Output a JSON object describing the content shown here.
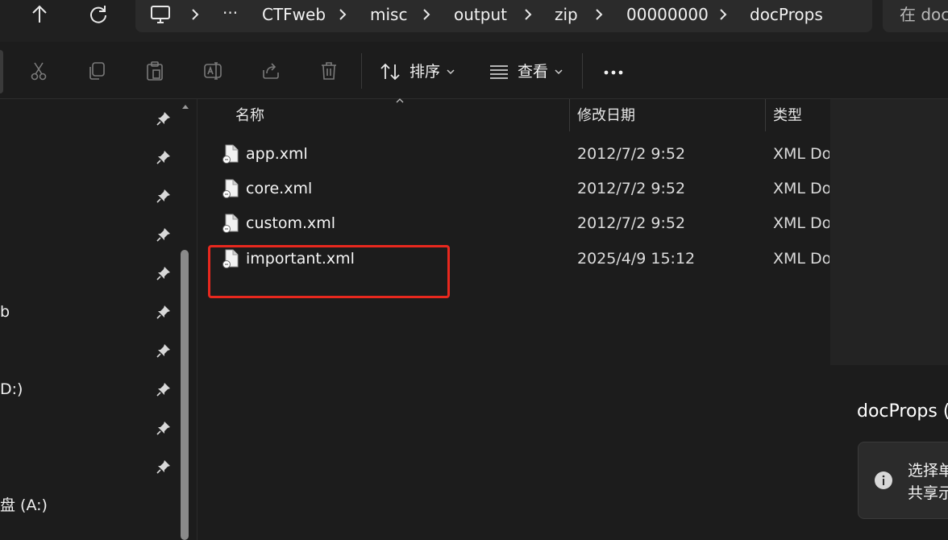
{
  "breadcrumb": {
    "items": [
      "CTFweb",
      "misc",
      "output",
      "zip",
      "00000000",
      "docProps"
    ]
  },
  "search": {
    "placeholder": "在 doc"
  },
  "toolbar": {
    "sort_label": "排序",
    "view_label": "查看"
  },
  "nav": {
    "partial_labels": [
      "b",
      "D:)",
      "盘 (A:)"
    ]
  },
  "file_list": {
    "columns": [
      "名称",
      "修改日期",
      "类型"
    ],
    "rows": [
      {
        "name": "app.xml",
        "date": "2012/7/2 9:52",
        "type": "XML Do"
      },
      {
        "name": "core.xml",
        "date": "2012/7/2 9:52",
        "type": "XML Do"
      },
      {
        "name": "custom.xml",
        "date": "2012/7/2 9:52",
        "type": "XML Do"
      },
      {
        "name": "important.xml",
        "date": "2025/4/9 15:12",
        "type": "XML Do"
      }
    ]
  },
  "details": {
    "title": "docProps (",
    "info_line1": "选择单",
    "info_line2": "共享示"
  },
  "colors": {
    "highlight": "#e8281e",
    "background": "#1c1c1c"
  }
}
